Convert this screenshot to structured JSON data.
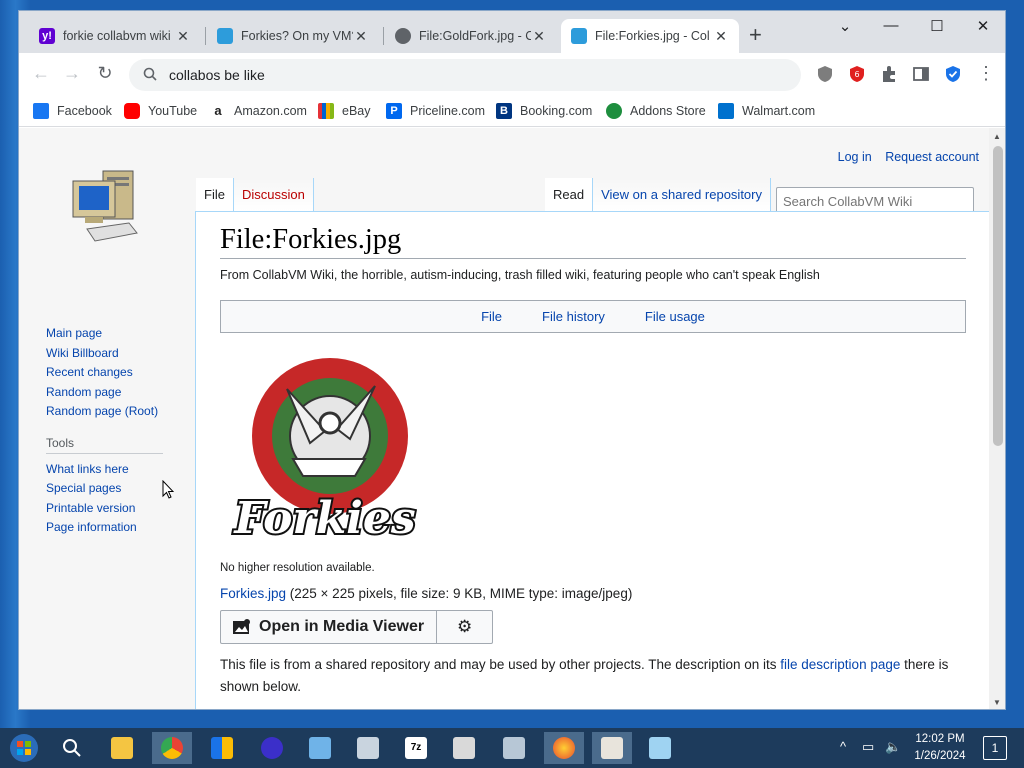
{
  "browser": {
    "tabs": [
      {
        "title": "forkie collabvm wiki",
        "favicon_color": "#6001d2"
      },
      {
        "title": "Forkies? On my VM?",
        "favicon_color": "#2d9cdb"
      },
      {
        "title": "File:GoldFork.jpg - C",
        "favicon_color": "#5f6368"
      },
      {
        "title": "File:Forkies.jpg - Col",
        "favicon_color": "#2d9cdb"
      }
    ],
    "new_tab": "+",
    "controls": {
      "minimize": "⌄",
      "maximize": "☐",
      "restore": "—",
      "close": "✕"
    },
    "address": "collabos be like",
    "bookmarks": [
      {
        "label": "Facebook",
        "color": "#1877f2"
      },
      {
        "label": "YouTube",
        "color": "#ff0000"
      },
      {
        "label": "Amazon.com",
        "color": "#222222"
      },
      {
        "label": "eBay",
        "color": "#e53238"
      },
      {
        "label": "Priceline.com",
        "color": "#0068ef"
      },
      {
        "label": "Booking.com",
        "color": "#003580"
      },
      {
        "label": "Addons Store",
        "color": "#1e8e3e"
      },
      {
        "label": "Walmart.com",
        "color": "#0071ce"
      }
    ]
  },
  "wiki": {
    "personal": {
      "login": "Log in",
      "request": "Request account"
    },
    "nav": [
      "Main page",
      "Wiki Billboard",
      "Recent changes",
      "Random page",
      "Random page (Root)"
    ],
    "tools_heading": "Tools",
    "tools": [
      "What links here",
      "Special pages",
      "Printable version",
      "Page information"
    ],
    "tabs_left": [
      {
        "label": "File"
      },
      {
        "label": "Discussion"
      }
    ],
    "tabs_right": [
      {
        "label": "Read"
      },
      {
        "label": "View on a shared repository"
      }
    ],
    "search_placeholder": "Search CollabVM Wiki",
    "title": "File:Forkies.jpg",
    "tagline": "From CollabVM Wiki, the horrible, autism-inducing, trash filled wiki, featuring people who can't speak English",
    "file_toc": [
      "File",
      "File history",
      "File usage"
    ],
    "image_wordmark": "Forkies",
    "no_higher": "No higher resolution available.",
    "file_link": "Forkies.jpg",
    "file_meta": " (225 × 225 pixels, file size: 9 KB, MIME type: image/jpeg)",
    "media_viewer": "Open in Media Viewer",
    "shared_text_1": "This file is from a shared repository and may be used by other projects. The description on its ",
    "shared_link": "file description page",
    "shared_text_2": " there is shown below."
  },
  "taskbar": {
    "time": "12:02 PM",
    "date": "1/26/2024",
    "notif_count": "1"
  }
}
